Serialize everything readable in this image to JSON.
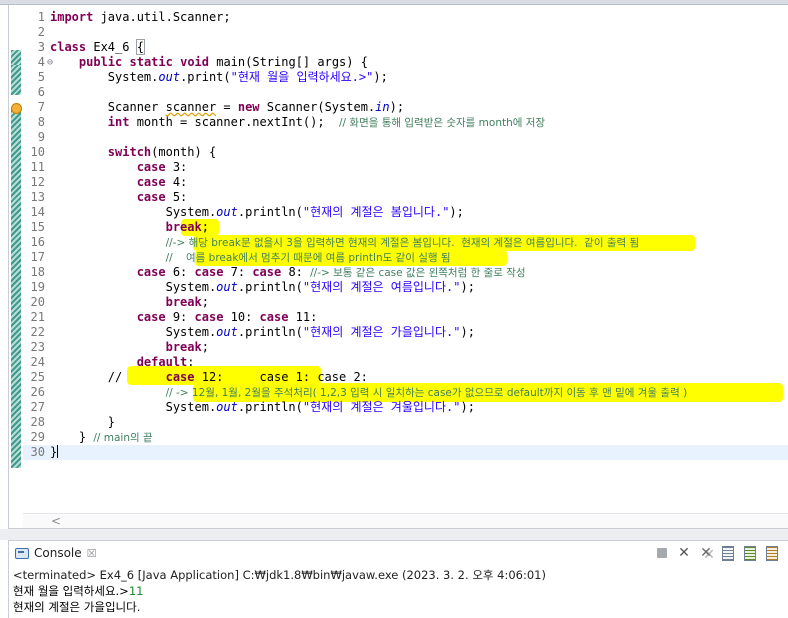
{
  "editor": {
    "lines": [
      {
        "n": "1",
        "fold": "",
        "segs": [
          {
            "t": "import",
            "c": "kw"
          },
          {
            "t": " java.util.Scanner;"
          }
        ]
      },
      {
        "n": "2",
        "fold": "",
        "segs": []
      },
      {
        "n": "3",
        "fold": "",
        "segs": [
          {
            "t": "class",
            "c": "kw"
          },
          {
            "t": " Ex4_6 "
          },
          {
            "t": "{",
            "c": "bracket"
          }
        ]
      },
      {
        "n": "4",
        "fold": "⊖",
        "segs": [
          {
            "t": "    "
          },
          {
            "t": "public",
            "c": "kw"
          },
          {
            "t": " "
          },
          {
            "t": "static",
            "c": "kw"
          },
          {
            "t": " "
          },
          {
            "t": "void",
            "c": "kw"
          },
          {
            "t": " main(String[] args) {"
          }
        ]
      },
      {
        "n": "5",
        "fold": "",
        "segs": [
          {
            "t": "        System."
          },
          {
            "t": "out",
            "c": "fld"
          },
          {
            "t": ".print("
          },
          {
            "t": "\"현재 월을 입력하세요.>\"",
            "c": "str"
          },
          {
            "t": ");"
          }
        ]
      },
      {
        "n": "6",
        "fold": "",
        "segs": []
      },
      {
        "n": "7",
        "fold": "",
        "segs": [
          {
            "t": "        Scanner "
          },
          {
            "t": "scanner",
            "c": "warn-word"
          },
          {
            "t": " = "
          },
          {
            "t": "new",
            "c": "kw"
          },
          {
            "t": " Scanner(System."
          },
          {
            "t": "in",
            "c": "fld"
          },
          {
            "t": ");"
          }
        ]
      },
      {
        "n": "8",
        "fold": "",
        "segs": [
          {
            "t": "        "
          },
          {
            "t": "int",
            "c": "kw"
          },
          {
            "t": " month = scanner.nextInt();  "
          },
          {
            "t": "// 화면을 통해 입력받은 숫자를 month에 저장",
            "c": "cmt"
          }
        ]
      },
      {
        "n": "9",
        "fold": "",
        "segs": []
      },
      {
        "n": "10",
        "fold": "",
        "segs": [
          {
            "t": "        "
          },
          {
            "t": "switch",
            "c": "kw"
          },
          {
            "t": "(month) {"
          }
        ]
      },
      {
        "n": "11",
        "fold": "",
        "segs": [
          {
            "t": "            "
          },
          {
            "t": "case",
            "c": "kw"
          },
          {
            "t": " 3:"
          }
        ]
      },
      {
        "n": "12",
        "fold": "",
        "segs": [
          {
            "t": "            "
          },
          {
            "t": "case",
            "c": "kw"
          },
          {
            "t": " 4:"
          }
        ]
      },
      {
        "n": "13",
        "fold": "",
        "segs": [
          {
            "t": "            "
          },
          {
            "t": "case",
            "c": "kw"
          },
          {
            "t": " 5:"
          }
        ]
      },
      {
        "n": "14",
        "fold": "",
        "segs": [
          {
            "t": "                System."
          },
          {
            "t": "out",
            "c": "fld"
          },
          {
            "t": ".println("
          },
          {
            "t": "\"현재의 계절은 봄입니다.\"",
            "c": "str"
          },
          {
            "t": ");"
          }
        ]
      },
      {
        "n": "15",
        "fold": "",
        "segs": [
          {
            "t": "                "
          },
          {
            "t": "break",
            "c": "kw"
          },
          {
            "t": ";"
          }
        ]
      },
      {
        "n": "16",
        "fold": "",
        "segs": [
          {
            "t": "                "
          },
          {
            "t": "//-> 해당 break문 없을시 3을 입력하면 현재의 계절은 봄입니다.  현재의 계절은 여름입니다.  같이 출력 됨",
            "c": "cmt"
          }
        ]
      },
      {
        "n": "17",
        "fold": "",
        "segs": [
          {
            "t": "                "
          },
          {
            "t": "//    여름 break에서 멈추기 때문에 여름 println도 같이 실행 됨",
            "c": "cmt"
          }
        ]
      },
      {
        "n": "18",
        "fold": "",
        "segs": [
          {
            "t": "            "
          },
          {
            "t": "case",
            "c": "kw"
          },
          {
            "t": " 6: "
          },
          {
            "t": "case",
            "c": "kw"
          },
          {
            "t": " 7: "
          },
          {
            "t": "case",
            "c": "kw"
          },
          {
            "t": " 8: "
          },
          {
            "t": "//-> 보통 같은 case 값은 왼쪽처럼 한 줄로 작성",
            "c": "cmt"
          }
        ]
      },
      {
        "n": "19",
        "fold": "",
        "segs": [
          {
            "t": "                System."
          },
          {
            "t": "out",
            "c": "fld"
          },
          {
            "t": ".println("
          },
          {
            "t": "\"현재의 계절은 여름입니다.\"",
            "c": "str"
          },
          {
            "t": ");"
          }
        ]
      },
      {
        "n": "20",
        "fold": "",
        "segs": [
          {
            "t": "                "
          },
          {
            "t": "break",
            "c": "kw"
          },
          {
            "t": ";"
          }
        ]
      },
      {
        "n": "21",
        "fold": "",
        "segs": [
          {
            "t": "            "
          },
          {
            "t": "case",
            "c": "kw"
          },
          {
            "t": " 9: "
          },
          {
            "t": "case",
            "c": "kw"
          },
          {
            "t": " 10: "
          },
          {
            "t": "case",
            "c": "kw"
          },
          {
            "t": " 11:"
          }
        ]
      },
      {
        "n": "22",
        "fold": "",
        "segs": [
          {
            "t": "                System."
          },
          {
            "t": "out",
            "c": "fld"
          },
          {
            "t": ".println("
          },
          {
            "t": "\"현재의 계절은 가을입니다.\"",
            "c": "str"
          },
          {
            "t": ");"
          }
        ]
      },
      {
        "n": "23",
        "fold": "",
        "segs": [
          {
            "t": "                "
          },
          {
            "t": "break",
            "c": "kw"
          },
          {
            "t": ";"
          }
        ]
      },
      {
        "n": "24",
        "fold": "",
        "segs": [
          {
            "t": "            "
          },
          {
            "t": "default",
            "c": "kw"
          },
          {
            "t": ":"
          }
        ]
      },
      {
        "n": "25",
        "fold": "",
        "segs": [
          {
            "t": "        //      "
          },
          {
            "t": "case",
            "c": "kw"
          },
          {
            "t": " 12:     case 1: case 2:"
          }
        ]
      },
      {
        "n": "26",
        "fold": "",
        "segs": [
          {
            "t": "                "
          },
          {
            "t": "// -> 12월, 1월, 2월을 주석처리( 1,2,3 입력 시 일치하는 case가 없으므로 default까지 이동 후 맨 밑에 겨울 출력 )",
            "c": "cmt"
          }
        ]
      },
      {
        "n": "27",
        "fold": "",
        "segs": [
          {
            "t": "                System."
          },
          {
            "t": "out",
            "c": "fld"
          },
          {
            "t": ".println("
          },
          {
            "t": "\"현재의 계절은 겨울입니다.\"",
            "c": "str"
          },
          {
            "t": ");"
          }
        ]
      },
      {
        "n": "28",
        "fold": "",
        "segs": [
          {
            "t": "        }"
          }
        ]
      },
      {
        "n": "29",
        "fold": "",
        "segs": [
          {
            "t": "    } "
          },
          {
            "t": "// main의 끝",
            "c": "cmt"
          }
        ]
      },
      {
        "n": "30",
        "fold": "",
        "segs": [
          {
            "t": "}"
          }
        ],
        "current": true
      }
    ]
  },
  "console": {
    "tab_label": "Console",
    "close_glyph": "☒",
    "terminated": "<terminated> Ex4_6 [Java Application] C:₩jdk1.8₩bin₩javaw.exe (2023. 3. 2. 오후 4:06:01)",
    "output_prompt": "현재 월을 입력하세요.>",
    "user_input": "11",
    "output_result": "현재의 계절은 가을입니다."
  },
  "colors": {
    "highlight": "#ffff00",
    "keyword": "#7f0055",
    "string": "#2a00ff",
    "comment": "#3f7f5f",
    "field": "#0000c0"
  },
  "icons": {
    "toolbar": [
      "stop-icon",
      "remove-launch-icon",
      "remove-all-icon",
      "scroll-lock-icon",
      "word-wrap-icon",
      "show-console-icon"
    ]
  }
}
